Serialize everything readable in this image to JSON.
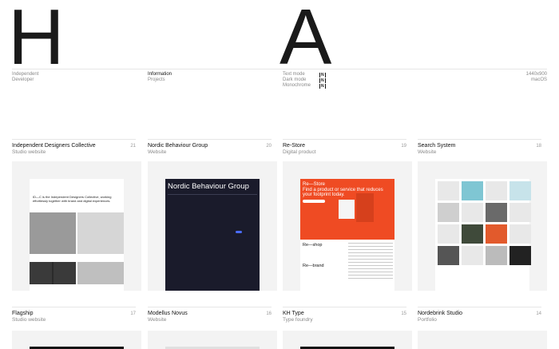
{
  "hero": {
    "left_letter": "H",
    "right_letter": "A"
  },
  "profile": {
    "line1": "Independent",
    "line2": "Developer"
  },
  "nav": {
    "information": "Information",
    "projects": "Projects"
  },
  "modes": [
    {
      "label": "Text mode",
      "toggle": "N"
    },
    {
      "label": "Dark mode",
      "toggle": "N"
    },
    {
      "label": "Monochrome",
      "toggle": "N"
    }
  ],
  "screen": {
    "resolution": "1440x900",
    "os": "macOS"
  },
  "projects": [
    {
      "title": "Independent Designers Collective",
      "type": "Studio website",
      "num": "21"
    },
    {
      "title": "Nordic Behaviour Group",
      "type": "Website",
      "num": "20"
    },
    {
      "title": "Re-Store",
      "type": "Digital product",
      "num": "19"
    },
    {
      "title": "Search System",
      "type": "Website",
      "num": "18"
    },
    {
      "title": "Flagship",
      "type": "Studio website",
      "num": "17"
    },
    {
      "title": "Modellus Novus",
      "type": "Website",
      "num": "16"
    },
    {
      "title": "KH Type",
      "type": "Type foundry",
      "num": "15"
    },
    {
      "title": "Nordebrink Studio",
      "type": "Portfolio",
      "num": "14"
    }
  ],
  "thumbs": {
    "idc_text": "ID—C is the Independent Designers Collective, working effortlessly together with brand and digital experiences.",
    "nbg_heading": "Nordic Behaviour Group",
    "rs_heading": "Re—Store",
    "rs_tagline": "Find a product or service that reduces your footprint today.",
    "rs_shop": "Re—shop",
    "rs_brand": "Re—brand"
  },
  "colors": {
    "accent_orange": "#ef4b23",
    "navy": "#1a1b2b",
    "link_blue": "#4a6cf7"
  }
}
